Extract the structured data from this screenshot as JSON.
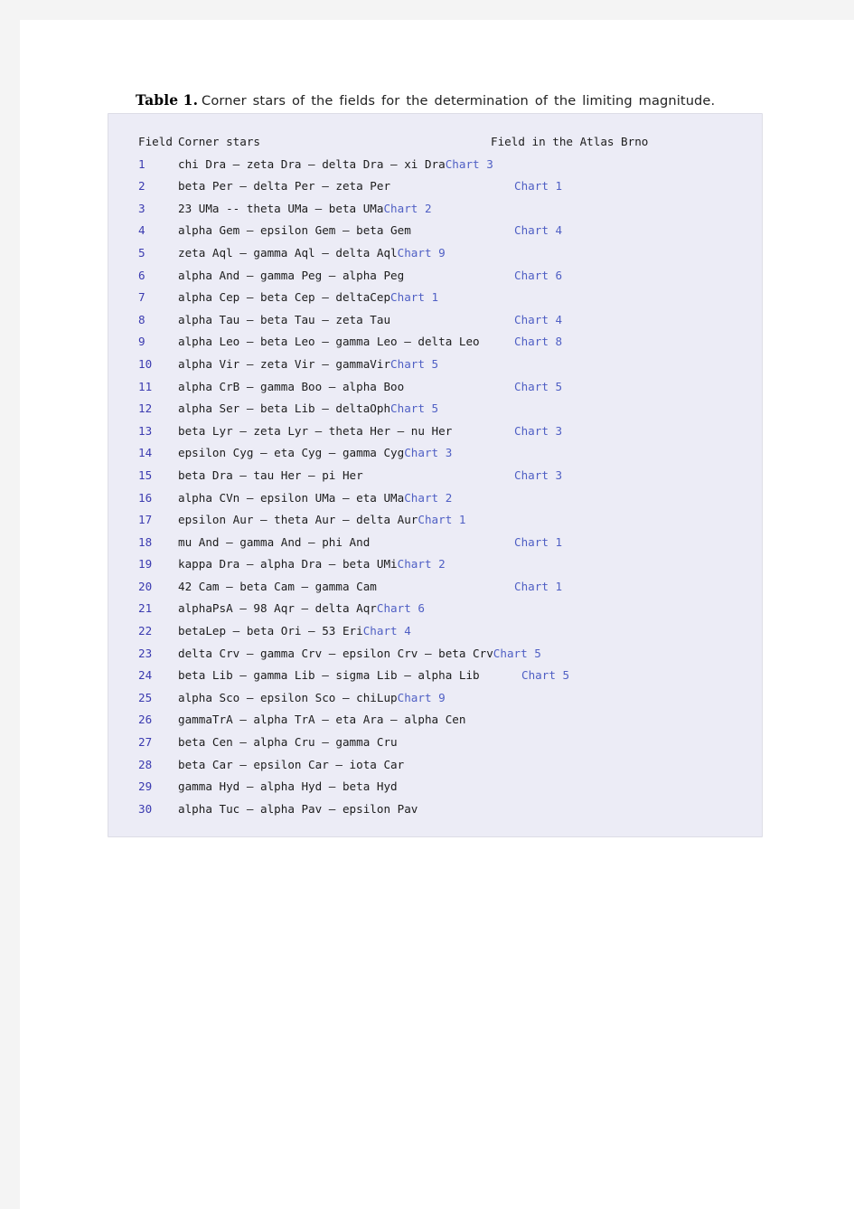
{
  "caption": {
    "label": "Table 1.",
    "text": "Corner stars of the fields for the determination of the limiting magnitude."
  },
  "colors": {
    "page_background": "#f4f4f4",
    "sheet": "#ffffff",
    "table_background": "#ececf6",
    "table_border": "#dddde6",
    "field_number": "#3b3bb0",
    "chart_link": "#4f5fc4",
    "body_text": "#1c1c1c"
  },
  "table": {
    "headers": {
      "field": "Field",
      "corner_stars": "Corner stars",
      "atlas": "Field in the Atlas Brno"
    },
    "rows": [
      {
        "num": "1",
        "stars": "chi Dra — zeta Dra — delta Dra — xi Dra",
        "chart": "Chart 3",
        "inline": true
      },
      {
        "num": "2",
        "stars": "beta Per — delta Per — zeta Per",
        "chart": "Chart 1",
        "inline": false
      },
      {
        "num": "3",
        "stars": "23 UMa -- theta UMa — beta UMa",
        "chart": "Chart 2",
        "inline": true
      },
      {
        "num": "4",
        "stars": "alpha Gem — epsilon Gem — beta Gem",
        "chart": "Chart 4",
        "inline": false
      },
      {
        "num": "5",
        "stars": "zeta Aql — gamma Aql — delta Aql",
        "chart": "Chart 9",
        "inline": true
      },
      {
        "num": "6",
        "stars": "alpha And — gamma Peg — alpha Peg",
        "chart": "Chart 6",
        "inline": false
      },
      {
        "num": "7",
        "stars": "alpha Cep — beta Cep — deltaCep",
        "chart": "Chart 1",
        "inline": true
      },
      {
        "num": "8",
        "stars": "alpha Tau — beta Tau — zeta Tau",
        "chart": "Chart 4",
        "inline": false
      },
      {
        "num": "9",
        "stars": "alpha Leo — beta Leo — gamma Leo — delta Leo",
        "chart": "Chart 8",
        "inline": false
      },
      {
        "num": "10",
        "stars": "alpha Vir — zeta Vir — gammaVir",
        "chart": "Chart 5",
        "inline": true
      },
      {
        "num": "11",
        "stars": "alpha CrB — gamma Boo — alpha Boo",
        "chart": "Chart 5",
        "inline": false
      },
      {
        "num": "12",
        "stars": "alpha Ser — beta Lib — deltaOph",
        "chart": "Chart 5",
        "inline": true
      },
      {
        "num": "13",
        "stars": "beta Lyr — zeta Lyr — theta Her — nu Her",
        "chart": "Chart 3",
        "inline": false
      },
      {
        "num": "14",
        "stars": "epsilon Cyg — eta Cyg — gamma Cyg",
        "chart": "Chart 3",
        "inline": true
      },
      {
        "num": "15",
        "stars": "beta Dra — tau Her — pi Her",
        "chart": "Chart 3",
        "inline": false
      },
      {
        "num": "16",
        "stars": "alpha CVn — epsilon UMa — eta UMa",
        "chart": "Chart 2",
        "inline": true
      },
      {
        "num": "17",
        "stars": "epsilon Aur — theta Aur — delta Aur",
        "chart": "Chart 1",
        "inline": true
      },
      {
        "num": "18",
        "stars": "mu And — gamma And — phi And",
        "chart": "Chart 1",
        "inline": false
      },
      {
        "num": "19",
        "stars": "kappa Dra — alpha Dra — beta UMi",
        "chart": "Chart 2",
        "inline": true
      },
      {
        "num": "20",
        "stars": "42 Cam — beta Cam — gamma Cam",
        "chart": "Chart 1",
        "inline": false
      },
      {
        "num": "21",
        "stars": "alphaPsA — 98 Aqr — delta Aqr",
        "chart": "Chart 6",
        "inline": true
      },
      {
        "num": "22",
        "stars": "betaLep — beta Ori — 53 Eri",
        "chart": "Chart 4",
        "inline": true
      },
      {
        "num": "23",
        "stars": "delta Crv — gamma Crv — epsilon Crv — beta Crv",
        "chart": "Chart 5",
        "inline": true
      },
      {
        "num": "24",
        "stars": "beta Lib — gamma Lib — sigma Lib — alpha Lib",
        "chart": "Chart 5",
        "inline": false,
        "offset": true
      },
      {
        "num": "25",
        "stars": "alpha Sco — epsilon Sco — chiLup",
        "chart": "Chart 9",
        "inline": true
      },
      {
        "num": "26",
        "stars": "gammaTrA — alpha TrA — eta Ara — alpha Cen",
        "chart": "",
        "inline": false
      },
      {
        "num": "27",
        "stars": "beta Cen — alpha Cru — gamma Cru",
        "chart": "",
        "inline": false
      },
      {
        "num": "28",
        "stars": "beta Car — epsilon Car — iota Car",
        "chart": "",
        "inline": false
      },
      {
        "num": "29",
        "stars": "gamma Hyd — alpha Hyd — beta Hyd",
        "chart": "",
        "inline": false
      },
      {
        "num": "30",
        "stars": "alpha Tuc — alpha Pav — epsilon Pav",
        "chart": "",
        "inline": false
      }
    ]
  }
}
